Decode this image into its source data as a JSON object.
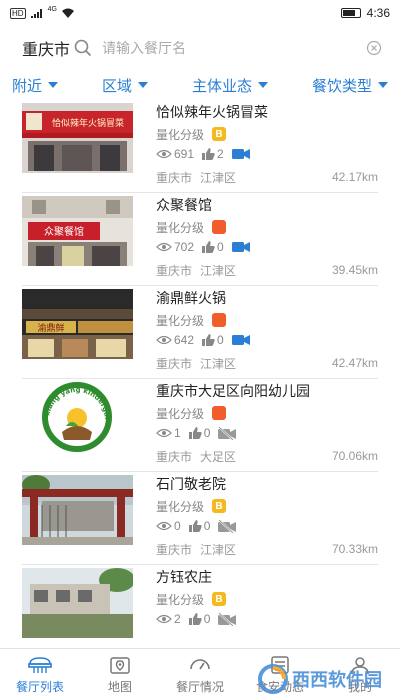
{
  "status_bar": {
    "signal_badge": "HD",
    "network": "4G",
    "battery_percent": 70,
    "time": "4:36",
    "icons": [
      "signal-icon",
      "wifi-icon",
      "battery-icon"
    ]
  },
  "search": {
    "city": "重庆市",
    "placeholder": "请输入餐厅名"
  },
  "filters": [
    "附近",
    "区域",
    "主体业态",
    "餐饮类型"
  ],
  "colors": {
    "accent": "#2a7fd4",
    "grade_b": "#f5b91e",
    "grade_orange": "#f25c2a"
  },
  "restaurants": [
    {
      "name": "恰似辣年火锅冒菜",
      "grade_label": "量化分级",
      "grade": "B",
      "grade_color": "#f5b91e",
      "views": "691",
      "likes": "2",
      "video": true,
      "city": "重庆市",
      "district": "江津区",
      "distance": "42.17km"
    },
    {
      "name": "众聚餐馆",
      "grade_label": "量化分级",
      "grade": "",
      "grade_color": "#f25c2a",
      "views": "702",
      "likes": "0",
      "video": true,
      "city": "重庆市",
      "district": "江津区",
      "distance": "39.45km"
    },
    {
      "name": "渝鼎鲜火锅",
      "grade_label": "量化分级",
      "grade": "",
      "grade_color": "#f25c2a",
      "views": "642",
      "likes": "0",
      "video": true,
      "city": "重庆市",
      "district": "江津区",
      "distance": "42.47km"
    },
    {
      "name": "重庆市大足区向阳幼儿园",
      "grade_label": "量化分级",
      "grade": "",
      "grade_color": "#f25c2a",
      "views": "1",
      "likes": "0",
      "video": false,
      "city": "重庆市",
      "district": "大足区",
      "distance": "70.06km"
    },
    {
      "name": "石门敬老院",
      "grade_label": "量化分级",
      "grade": "B",
      "grade_color": "#f5b91e",
      "views": "0",
      "likes": "0",
      "video": false,
      "city": "重庆市",
      "district": "江津区",
      "distance": "70.33km"
    },
    {
      "name": "方钰农庄",
      "grade_label": "量化分级",
      "grade": "B",
      "grade_color": "#f5b91e",
      "views": "2",
      "likes": "0",
      "video": false,
      "city": "",
      "district": "",
      "distance": ""
    }
  ],
  "thumbnails": [
    {
      "sign_text": "恰似辣年火锅冒菜"
    },
    {
      "sign_text": "众聚餐馆"
    },
    {
      "sign_text": "渝鼎鲜"
    },
    {
      "sign_text": "xiang yang kindergarten"
    },
    {
      "sign_text": ""
    },
    {
      "sign_text": ""
    }
  ],
  "tabbar": {
    "tabs": [
      {
        "label": "餐厅列表",
        "icon": "restaurant-list-icon",
        "active": true
      },
      {
        "label": "地图",
        "icon": "map-icon",
        "active": false
      },
      {
        "label": "餐厅情况",
        "icon": "dashboard-icon",
        "active": false
      },
      {
        "label": "食安动态",
        "icon": "news-icon",
        "active": false
      },
      {
        "label": "我的",
        "icon": "profile-icon",
        "active": false
      }
    ]
  },
  "watermark": "西西软件园"
}
